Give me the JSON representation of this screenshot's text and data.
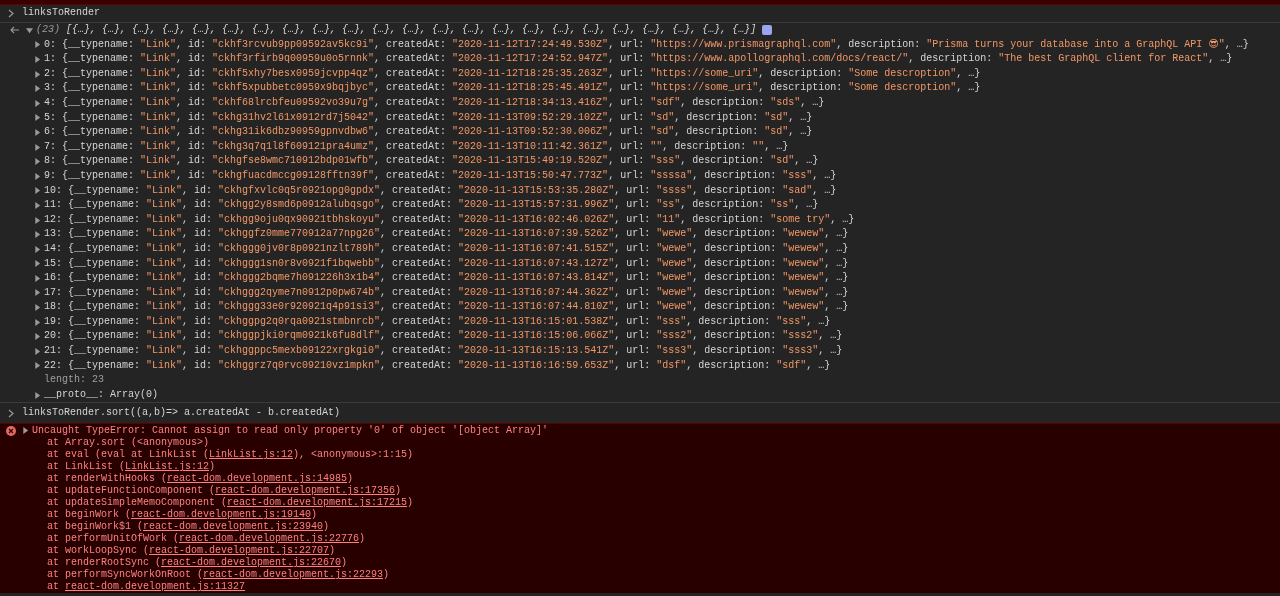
{
  "console": {
    "input_1": {
      "code": "linksToRender"
    },
    "output": {
      "count": "(23)",
      "preview": "[{…}, {…}, {…}, {…}, {…}, {…}, {…}, {…}, {…}, {…}, {…}, {…}, {…}, {…}, {…}, {…}, {…}, {…}, {…}, {…}, {…}, {…}, {…}]",
      "expanded": true,
      "rows": [
        {
          "expanded": false,
          "text": "0: {__typename: \"Link\", id: \"ckhf3rcvub9pp09592av5kc9i\", createdAt: \"2020-11-12T17:24:49.530Z\", url: \"https://www.prismagraphql.com\", description: \"Prisma turns your database into a GraphQL API 😎\", …}"
        },
        {
          "expanded": false,
          "text": "1: {__typename: \"Link\", id: \"ckhf3rfirb9q00959u0o5rnnk\", createdAt: \"2020-11-12T17:24:52.947Z\", url: \"https://www.apollographql.com/docs/react/\", description: \"The best GraphQL client for React\", …}"
        },
        {
          "expanded": false,
          "text": "2: {__typename: \"Link\", id: \"ckhf5xhy7besx0959jcvpp4qz\", createdAt: \"2020-11-12T18:25:35.263Z\", url: \"https://some_uri\", description: \"Some descroption\", …}"
        },
        {
          "expanded": false,
          "text": "3: {__typename: \"Link\", id: \"ckhf5xpubbetc0959x9bqjbyc\", createdAt: \"2020-11-12T18:25:45.491Z\", url: \"https://some_uri\", description: \"Some descroption\", …}"
        },
        {
          "expanded": false,
          "text": "4: {__typename: \"Link\", id: \"ckhf68lrcbfeu09592vo39u7g\", createdAt: \"2020-11-12T18:34:13.416Z\", url: \"sdf\", description: \"sds\", …}"
        },
        {
          "expanded": false,
          "text": "5: {__typename: \"Link\", id: \"ckhg31hv2l61x0912rd7j5042\", createdAt: \"2020-11-13T09:52:29.102Z\", url: \"sd\", description: \"sd\", …}"
        },
        {
          "expanded": false,
          "text": "6: {__typename: \"Link\", id: \"ckhg31ik6dbz90959gpnvdbw6\", createdAt: \"2020-11-13T09:52:30.006Z\", url: \"sd\", description: \"sd\", …}"
        },
        {
          "expanded": false,
          "text": "7: {__typename: \"Link\", id: \"ckhg3q7q1l8f609121pra4umz\", createdAt: \"2020-11-13T10:11:42.361Z\", url: \"\", description: \"\", …}"
        },
        {
          "expanded": false,
          "text": "8: {__typename: \"Link\", id: \"ckhgfse8wmc710912bdp01wfb\", createdAt: \"2020-11-13T15:49:19.520Z\", url: \"sss\", description: \"sd\", …}"
        },
        {
          "expanded": false,
          "text": "9: {__typename: \"Link\", id: \"ckhgfuacdmccg09128fftn39f\", createdAt: \"2020-11-13T15:50:47.773Z\", url: \"ssssa\", description: \"sss\", …}"
        },
        {
          "expanded": false,
          "text": "10: {__typename: \"Link\", id: \"ckhgfxvlc0q5r0921opg0gpdx\", createdAt: \"2020-11-13T15:53:35.280Z\", url: \"ssss\", description: \"sad\", …}"
        },
        {
          "expanded": false,
          "text": "11: {__typename: \"Link\", id: \"ckhgg2y8smd6p0912alubqsgo\", createdAt: \"2020-11-13T15:57:31.996Z\", url: \"ss\", description: \"ss\", …}"
        },
        {
          "expanded": false,
          "text": "12: {__typename: \"Link\", id: \"ckhgg9oju0qx90921tbhskoyu\", createdAt: \"2020-11-13T16:02:46.026Z\", url: \"11\", description: \"some try\", …}"
        },
        {
          "expanded": false,
          "text": "13: {__typename: \"Link\", id: \"ckhggfz0mme770912a77npg26\", createdAt: \"2020-11-13T16:07:39.526Z\", url: \"wewe\", description: \"wewew\", …}"
        },
        {
          "expanded": false,
          "text": "14: {__typename: \"Link\", id: \"ckhggg0jv0r8p0921nzlt789h\", createdAt: \"2020-11-13T16:07:41.515Z\", url: \"wewe\", description: \"wewew\", …}"
        },
        {
          "expanded": false,
          "text": "15: {__typename: \"Link\", id: \"ckhggg1sn0r8v0921f1bqwebb\", createdAt: \"2020-11-13T16:07:43.127Z\", url: \"wewe\", description: \"wewew\", …}"
        },
        {
          "expanded": false,
          "text": "16: {__typename: \"Link\", id: \"ckhggg2bqme7h091226h3x1b4\", createdAt: \"2020-11-13T16:07:43.814Z\", url: \"wewe\", description: \"wewew\", …}"
        },
        {
          "expanded": false,
          "text": "17: {__typename: \"Link\", id: \"ckhggg2qyme7n0912p0pw674b\", createdAt: \"2020-11-13T16:07:44.362Z\", url: \"wewe\", description: \"wewew\", …}"
        },
        {
          "expanded": false,
          "text": "18: {__typename: \"Link\", id: \"ckhggg33e0r920921q4p91si3\", createdAt: \"2020-11-13T16:07:44.810Z\", url: \"wewe\", description: \"wewew\", …}"
        },
        {
          "expanded": false,
          "text": "19: {__typename: \"Link\", id: \"ckhggpg2q0rqa0921stmbnrcb\", createdAt: \"2020-11-13T16:15:01.538Z\", url: \"sss\", description: \"sss\", …}"
        },
        {
          "expanded": false,
          "text": "20: {__typename: \"Link\", id: \"ckhggpjki0rqm0921k6fu8dlf\", createdAt: \"2020-11-13T16:15:06.066Z\", url: \"sss2\", description: \"sss2\", …}"
        },
        {
          "expanded": false,
          "text": "21: {__typename: \"Link\", id: \"ckhggppc5mexb09122xrgkgi0\", createdAt: \"2020-11-13T16:15:13.541Z\", url: \"sss3\", description: \"sss3\", …}"
        },
        {
          "expanded": false,
          "text": "22: {__typename: \"Link\", id: \"ckhggrz7q0rvc09210vz1mpkn\", createdAt: \"2020-11-13T16:16:59.653Z\", url: \"dsf\", description: \"sdf\", …}"
        }
      ],
      "length": "length: 23",
      "proto": {
        "text": "__proto__: Array(0)",
        "expanded": false
      }
    },
    "input_2": {
      "code": "linksToRender.sort((a,b)=> a.createdAt - b.createdAt)"
    },
    "error": {
      "message": "Uncaught TypeError: Cannot assign to read only property '0' of object '[object Array]'",
      "expanded": false,
      "stack": [
        {
          "before": "at Array.sort (<anonymous>)"
        },
        {
          "before": "at eval (eval at LinkList (",
          "link": "LinkList.js:12",
          "after": "), <anonymous>:1:15)"
        },
        {
          "before": "at LinkList (",
          "link": "LinkList.js:12",
          "after": ")"
        },
        {
          "before": "at renderWithHooks (",
          "link": "react-dom.development.js:14985",
          "after": ")"
        },
        {
          "before": "at updateFunctionComponent (",
          "link": "react-dom.development.js:17356",
          "after": ")"
        },
        {
          "before": "at updateSimpleMemoComponent (",
          "link": "react-dom.development.js:17215",
          "after": ")"
        },
        {
          "before": "at beginWork (",
          "link": "react-dom.development.js:19140",
          "after": ")"
        },
        {
          "before": "at beginWork$1 (",
          "link": "react-dom.development.js:23940",
          "after": ")"
        },
        {
          "before": "at performUnitOfWork (",
          "link": "react-dom.development.js:22776",
          "after": ")"
        },
        {
          "before": "at workLoopSync (",
          "link": "react-dom.development.js:22707",
          "after": ")"
        },
        {
          "before": "at renderRootSync (",
          "link": "react-dom.development.js:22670",
          "after": ")"
        },
        {
          "before": "at performSyncWorkOnRoot (",
          "link": "react-dom.development.js:22293",
          "after": ")"
        },
        {
          "before": "at ",
          "link": "react-dom.development.js:11327"
        }
      ]
    }
  }
}
